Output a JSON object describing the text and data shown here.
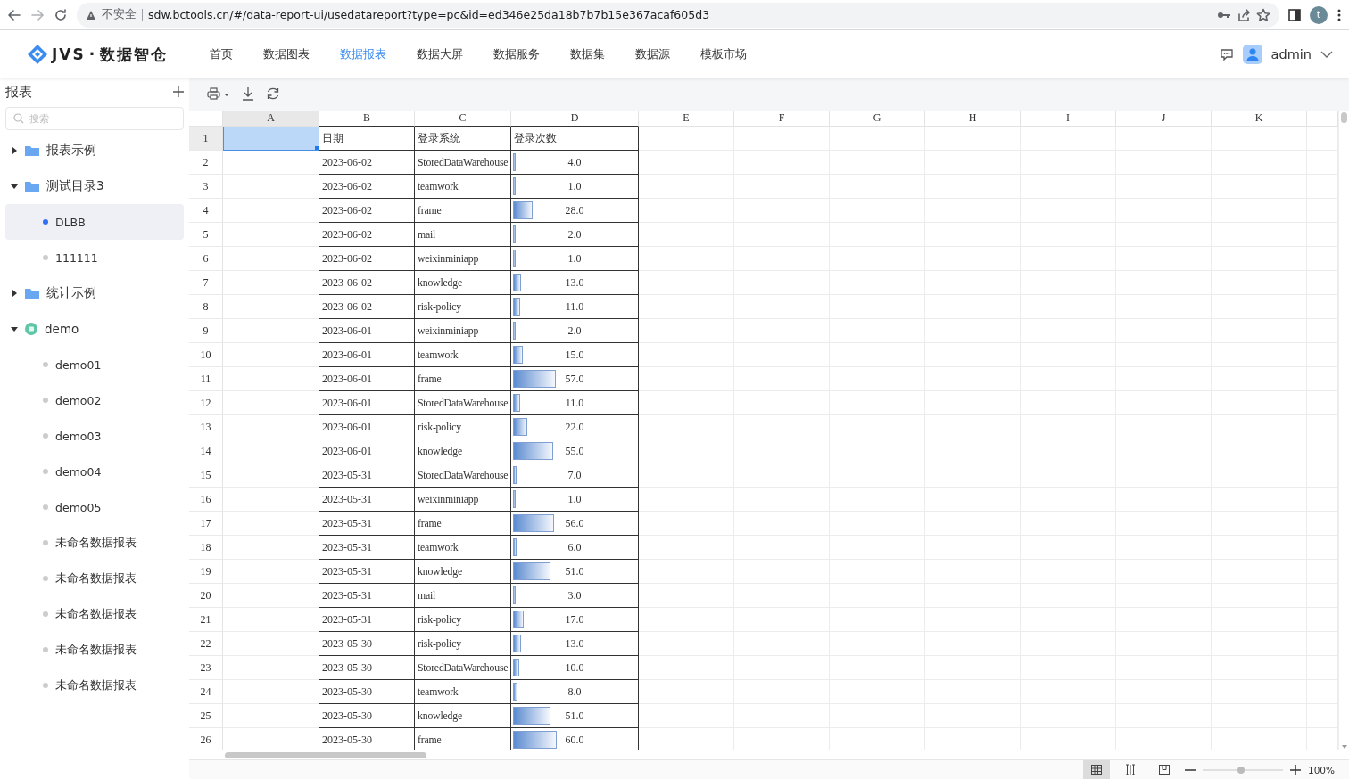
{
  "browser": {
    "security": "不安全",
    "url": "sdw.bctools.cn/#/data-report-ui/usedatareport?type=pc&id=ed346e25da18b7b7b15e367acaf605d3",
    "profile": "t"
  },
  "header": {
    "logo_mark": "JVS",
    "logo_dot": "·",
    "logo_name": "数据智仓",
    "nav": [
      {
        "label": "首页",
        "selected": false
      },
      {
        "label": "数据图表",
        "selected": false
      },
      {
        "label": "数据报表",
        "selected": true
      },
      {
        "label": "数据大屏",
        "selected": false
      },
      {
        "label": "数据服务",
        "selected": false
      },
      {
        "label": "数据集",
        "selected": false
      },
      {
        "label": "数据源",
        "selected": false
      },
      {
        "label": "模板市场",
        "selected": false
      }
    ],
    "user": "admin"
  },
  "sidebar": {
    "title": "报表",
    "search": {
      "placeholder": "搜索"
    },
    "tree": [
      {
        "label": "报表示例",
        "kind": "folder",
        "expanded": false,
        "selected": false
      },
      {
        "label": "测试目录3",
        "kind": "folder",
        "expanded": true,
        "selected": false,
        "children": [
          {
            "label": "DLBB",
            "kind": "report",
            "selected": true
          },
          {
            "label": "111111",
            "kind": "report",
            "selected": false
          }
        ]
      },
      {
        "label": "统计示例",
        "kind": "folder",
        "expanded": false,
        "selected": false
      },
      {
        "label": "demo",
        "kind": "app",
        "expanded": true,
        "selected": false,
        "children": [
          {
            "label": "demo01",
            "kind": "report",
            "selected": false
          },
          {
            "label": "demo02",
            "kind": "report",
            "selected": false
          },
          {
            "label": "demo03",
            "kind": "report",
            "selected": false
          },
          {
            "label": "demo04",
            "kind": "report",
            "selected": false
          },
          {
            "label": "demo05",
            "kind": "report",
            "selected": false
          },
          {
            "label": "未命名数据报表",
            "kind": "report",
            "selected": false
          },
          {
            "label": "未命名数据报表",
            "kind": "report",
            "selected": false
          },
          {
            "label": "未命名数据报表",
            "kind": "report",
            "selected": false
          },
          {
            "label": "未命名数据报表",
            "kind": "report",
            "selected": false
          },
          {
            "label": "未命名数据报表",
            "kind": "report",
            "selected": false
          }
        ]
      }
    ]
  },
  "sheet": {
    "columns": [
      {
        "label": "A",
        "selected": true
      },
      {
        "label": "B",
        "selected": false
      },
      {
        "label": "C",
        "selected": false
      },
      {
        "label": "D",
        "selected": false
      },
      {
        "label": "E",
        "selected": false
      },
      {
        "label": "F",
        "selected": false
      },
      {
        "label": "G",
        "selected": false
      },
      {
        "label": "H",
        "selected": false
      },
      {
        "label": "I",
        "selected": false
      },
      {
        "label": "J",
        "selected": false
      },
      {
        "label": "K",
        "selected": false
      }
    ],
    "header_row": {
      "number": "1",
      "selected": true,
      "cells": [
        "日期",
        "登录系统",
        "登录次数"
      ]
    },
    "data_rows": [
      {
        "number": "2",
        "date": "2023-06-02",
        "system": "StoredDataWarehouse",
        "count": "4.0",
        "level": 0.02
      },
      {
        "number": "3",
        "date": "2023-06-02",
        "system": "teamwork",
        "count": "1.0",
        "level": 0.01
      },
      {
        "number": "4",
        "date": "2023-06-02",
        "system": "frame",
        "count": "28.0",
        "level": 0.17
      },
      {
        "number": "5",
        "date": "2023-06-02",
        "system": "mail",
        "count": "2.0",
        "level": 0.01
      },
      {
        "number": "6",
        "date": "2023-06-02",
        "system": "weixinminiapp",
        "count": "1.0",
        "level": 0.01
      },
      {
        "number": "7",
        "date": "2023-06-02",
        "system": "knowledge",
        "count": "13.0",
        "level": 0.08
      },
      {
        "number": "8",
        "date": "2023-06-02",
        "system": "risk-policy",
        "count": "11.0",
        "level": 0.07
      },
      {
        "number": "9",
        "date": "2023-06-01",
        "system": "weixinminiapp",
        "count": "2.0",
        "level": 0.01
      },
      {
        "number": "10",
        "date": "2023-06-01",
        "system": "teamwork",
        "count": "15.0",
        "level": 0.09
      },
      {
        "number": "11",
        "date": "2023-06-01",
        "system": "frame",
        "count": "57.0",
        "level": 0.35
      },
      {
        "number": "12",
        "date": "2023-06-01",
        "system": "StoredDataWarehouse",
        "count": "11.0",
        "level": 0.07
      },
      {
        "number": "13",
        "date": "2023-06-01",
        "system": "risk-policy",
        "count": "22.0",
        "level": 0.13
      },
      {
        "number": "14",
        "date": "2023-06-01",
        "system": "knowledge",
        "count": "55.0",
        "level": 0.33
      },
      {
        "number": "15",
        "date": "2023-05-31",
        "system": "StoredDataWarehouse",
        "count": "7.0",
        "level": 0.04
      },
      {
        "number": "16",
        "date": "2023-05-31",
        "system": "weixinminiapp",
        "count": "1.0",
        "level": 0.01
      },
      {
        "number": "17",
        "date": "2023-05-31",
        "system": "frame",
        "count": "56.0",
        "level": 0.34
      },
      {
        "number": "18",
        "date": "2023-05-31",
        "system": "teamwork",
        "count": "6.0",
        "level": 0.04
      },
      {
        "number": "19",
        "date": "2023-05-31",
        "system": "knowledge",
        "count": "51.0",
        "level": 0.31
      },
      {
        "number": "20",
        "date": "2023-05-31",
        "system": "mail",
        "count": "3.0",
        "level": 0.02
      },
      {
        "number": "21",
        "date": "2023-05-31",
        "system": "risk-policy",
        "count": "17.0",
        "level": 0.1
      },
      {
        "number": "22",
        "date": "2023-05-30",
        "system": "risk-policy",
        "count": "13.0",
        "level": 0.08
      },
      {
        "number": "23",
        "date": "2023-05-30",
        "system": "StoredDataWarehouse",
        "count": "10.0",
        "level": 0.06
      },
      {
        "number": "24",
        "date": "2023-05-30",
        "system": "teamwork",
        "count": "8.0",
        "level": 0.05
      },
      {
        "number": "25",
        "date": "2023-05-30",
        "system": "knowledge",
        "count": "51.0",
        "level": 0.31
      },
      {
        "number": "26",
        "date": "2023-05-30",
        "system": "frame",
        "count": "60.0",
        "level": 0.36
      }
    ]
  },
  "status_bar": {
    "view_modes": [
      {
        "kind": "grid",
        "selected": true
      },
      {
        "kind": "split",
        "selected": false
      },
      {
        "kind": "page",
        "selected": false
      }
    ],
    "zoom": {
      "level": 0.48,
      "reading": "100%"
    }
  }
}
